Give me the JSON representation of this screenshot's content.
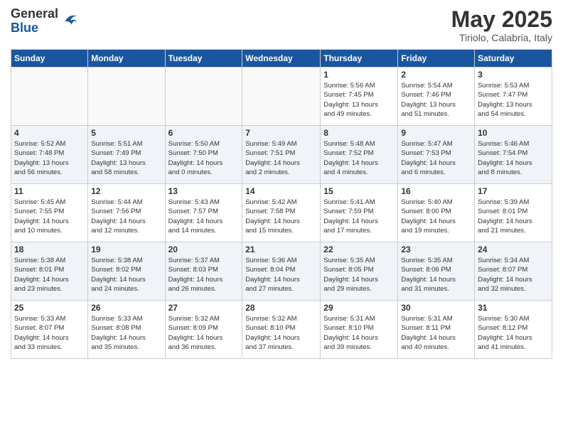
{
  "header": {
    "logo_line1": "General",
    "logo_line2": "Blue",
    "month": "May 2025",
    "location": "Tiriolo, Calabria, Italy"
  },
  "weekdays": [
    "Sunday",
    "Monday",
    "Tuesday",
    "Wednesday",
    "Thursday",
    "Friday",
    "Saturday"
  ],
  "weeks": [
    [
      {
        "day": "",
        "info": ""
      },
      {
        "day": "",
        "info": ""
      },
      {
        "day": "",
        "info": ""
      },
      {
        "day": "",
        "info": ""
      },
      {
        "day": "1",
        "info": "Sunrise: 5:56 AM\nSunset: 7:45 PM\nDaylight: 13 hours\nand 49 minutes."
      },
      {
        "day": "2",
        "info": "Sunrise: 5:54 AM\nSunset: 7:46 PM\nDaylight: 13 hours\nand 51 minutes."
      },
      {
        "day": "3",
        "info": "Sunrise: 5:53 AM\nSunset: 7:47 PM\nDaylight: 13 hours\nand 54 minutes."
      }
    ],
    [
      {
        "day": "4",
        "info": "Sunrise: 5:52 AM\nSunset: 7:48 PM\nDaylight: 13 hours\nand 56 minutes."
      },
      {
        "day": "5",
        "info": "Sunrise: 5:51 AM\nSunset: 7:49 PM\nDaylight: 13 hours\nand 58 minutes."
      },
      {
        "day": "6",
        "info": "Sunrise: 5:50 AM\nSunset: 7:50 PM\nDaylight: 14 hours\nand 0 minutes."
      },
      {
        "day": "7",
        "info": "Sunrise: 5:49 AM\nSunset: 7:51 PM\nDaylight: 14 hours\nand 2 minutes."
      },
      {
        "day": "8",
        "info": "Sunrise: 5:48 AM\nSunset: 7:52 PM\nDaylight: 14 hours\nand 4 minutes."
      },
      {
        "day": "9",
        "info": "Sunrise: 5:47 AM\nSunset: 7:53 PM\nDaylight: 14 hours\nand 6 minutes."
      },
      {
        "day": "10",
        "info": "Sunrise: 5:46 AM\nSunset: 7:54 PM\nDaylight: 14 hours\nand 8 minutes."
      }
    ],
    [
      {
        "day": "11",
        "info": "Sunrise: 5:45 AM\nSunset: 7:55 PM\nDaylight: 14 hours\nand 10 minutes."
      },
      {
        "day": "12",
        "info": "Sunrise: 5:44 AM\nSunset: 7:56 PM\nDaylight: 14 hours\nand 12 minutes."
      },
      {
        "day": "13",
        "info": "Sunrise: 5:43 AM\nSunset: 7:57 PM\nDaylight: 14 hours\nand 14 minutes."
      },
      {
        "day": "14",
        "info": "Sunrise: 5:42 AM\nSunset: 7:58 PM\nDaylight: 14 hours\nand 15 minutes."
      },
      {
        "day": "15",
        "info": "Sunrise: 5:41 AM\nSunset: 7:59 PM\nDaylight: 14 hours\nand 17 minutes."
      },
      {
        "day": "16",
        "info": "Sunrise: 5:40 AM\nSunset: 8:00 PM\nDaylight: 14 hours\nand 19 minutes."
      },
      {
        "day": "17",
        "info": "Sunrise: 5:39 AM\nSunset: 8:01 PM\nDaylight: 14 hours\nand 21 minutes."
      }
    ],
    [
      {
        "day": "18",
        "info": "Sunrise: 5:38 AM\nSunset: 8:01 PM\nDaylight: 14 hours\nand 23 minutes."
      },
      {
        "day": "19",
        "info": "Sunrise: 5:38 AM\nSunset: 8:02 PM\nDaylight: 14 hours\nand 24 minutes."
      },
      {
        "day": "20",
        "info": "Sunrise: 5:37 AM\nSunset: 8:03 PM\nDaylight: 14 hours\nand 26 minutes."
      },
      {
        "day": "21",
        "info": "Sunrise: 5:36 AM\nSunset: 8:04 PM\nDaylight: 14 hours\nand 27 minutes."
      },
      {
        "day": "22",
        "info": "Sunrise: 5:35 AM\nSunset: 8:05 PM\nDaylight: 14 hours\nand 29 minutes."
      },
      {
        "day": "23",
        "info": "Sunrise: 5:35 AM\nSunset: 8:06 PM\nDaylight: 14 hours\nand 31 minutes."
      },
      {
        "day": "24",
        "info": "Sunrise: 5:34 AM\nSunset: 8:07 PM\nDaylight: 14 hours\nand 32 minutes."
      }
    ],
    [
      {
        "day": "25",
        "info": "Sunrise: 5:33 AM\nSunset: 8:07 PM\nDaylight: 14 hours\nand 33 minutes."
      },
      {
        "day": "26",
        "info": "Sunrise: 5:33 AM\nSunset: 8:08 PM\nDaylight: 14 hours\nand 35 minutes."
      },
      {
        "day": "27",
        "info": "Sunrise: 5:32 AM\nSunset: 8:09 PM\nDaylight: 14 hours\nand 36 minutes."
      },
      {
        "day": "28",
        "info": "Sunrise: 5:32 AM\nSunset: 8:10 PM\nDaylight: 14 hours\nand 37 minutes."
      },
      {
        "day": "29",
        "info": "Sunrise: 5:31 AM\nSunset: 8:10 PM\nDaylight: 14 hours\nand 39 minutes."
      },
      {
        "day": "30",
        "info": "Sunrise: 5:31 AM\nSunset: 8:11 PM\nDaylight: 14 hours\nand 40 minutes."
      },
      {
        "day": "31",
        "info": "Sunrise: 5:30 AM\nSunset: 8:12 PM\nDaylight: 14 hours\nand 41 minutes."
      }
    ]
  ]
}
